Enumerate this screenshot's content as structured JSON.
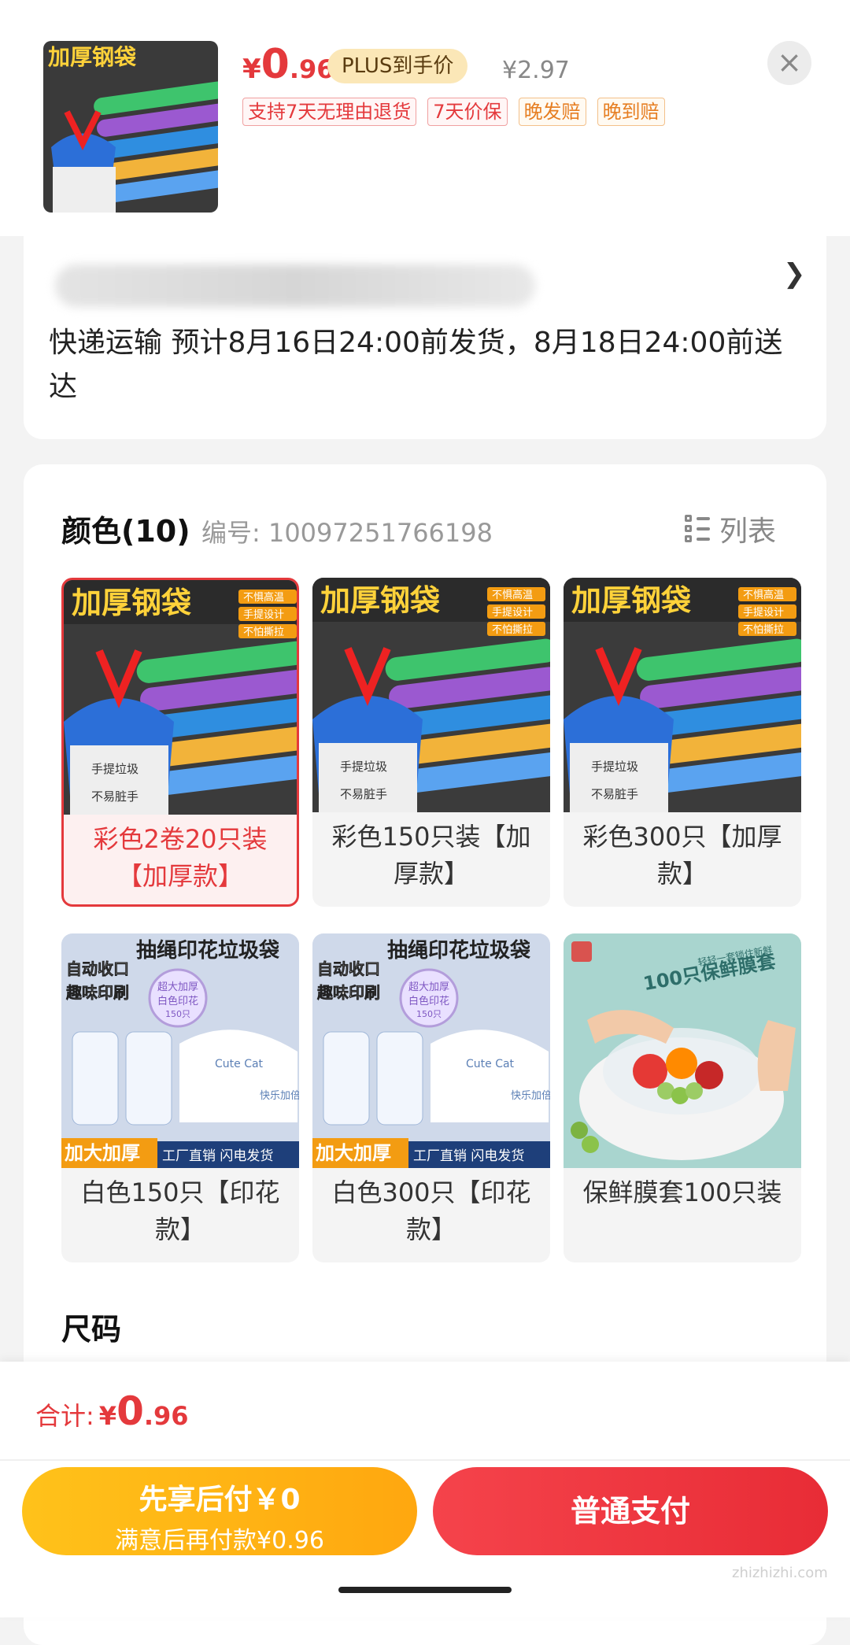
{
  "product": {
    "price_currency": "¥",
    "price_integer": "0",
    "price_decimal": ".96",
    "plus_label": "PLUS到手价",
    "original_price": "¥2.97",
    "tags": [
      "支持7天无理由退货",
      "7天价保",
      "晚发赔",
      "晚到赔"
    ],
    "close_icon": "close-icon"
  },
  "shipping": {
    "text": "快递运输 预计8月16日24:00前发货，8月18日24:00前送达"
  },
  "color_section": {
    "title": "颜色(10)",
    "code": "编号: 10097251766198",
    "list_label": "列表",
    "items": [
      {
        "label": "彩色2卷20只装【加厚款】",
        "selected": true
      },
      {
        "label": "彩色150只装【加厚款】",
        "selected": false
      },
      {
        "label": "彩色300只【加厚款】",
        "selected": false
      },
      {
        "label": "白色150只【印花款】",
        "selected": false
      },
      {
        "label": "白色300只【印花款】",
        "selected": false
      },
      {
        "label": "保鲜膜套100只装",
        "selected": false
      }
    ],
    "img_text": {
      "bag_title": "加厚钢袋",
      "bag_bullets": [
        "不惧高温",
        "手提设计",
        "不怕撕拉"
      ],
      "bag_cup": [
        "手提垃圾",
        "不易脏手"
      ],
      "print_title": "抽绳印花垃圾袋",
      "print_side": [
        "自动收口",
        "趣味印刷"
      ],
      "print_badge": [
        "超大加厚",
        "白色印花",
        "150只"
      ],
      "print_bottom_left": "加大加厚",
      "print_bottom_right": "工厂直销 闪电发货",
      "print_pack_text": [
        "Cute Cat",
        "快乐加倍"
      ],
      "film_title": "100只保鲜膜套",
      "film_small": "轻轻一套锁住新鲜"
    }
  },
  "size_section": {
    "title": "尺码"
  },
  "footer": {
    "total_label": "合计:",
    "total_currency": "¥",
    "total_integer": "0",
    "total_decimal": ".96",
    "pay_later_title": "先享后付￥0",
    "pay_later_sub": "满意后再付款¥0.96",
    "pay_normal": "普通支付"
  },
  "watermark": "zhizhizhi.com",
  "colors": {
    "accent_red": "#e4393c",
    "pay_later_yellow": "#ffb515",
    "plus_badge_bg": "#fbe7b7"
  }
}
